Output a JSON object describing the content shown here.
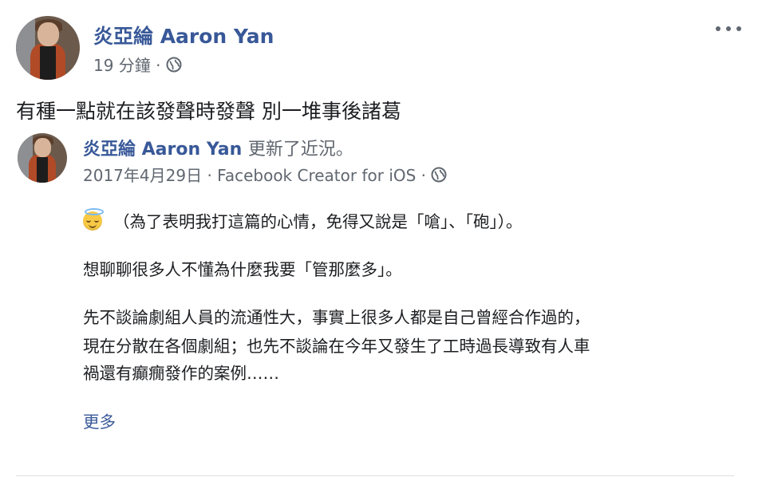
{
  "post": {
    "author": "炎亞綸 Aaron Yan",
    "time": "19 分鐘",
    "separator": "·",
    "text": "有種一點就在該發聲時發聲 別一堆事後諸葛",
    "privacy_icon": "globe-icon",
    "options_icon": "more-options-icon"
  },
  "shared": {
    "author": "炎亞綸 Aaron Yan",
    "action": "更新了近況。",
    "date": "2017年4月29日",
    "separator": "·",
    "source": "Facebook Creator for iOS",
    "privacy_icon": "globe-icon",
    "emoji_icon": "smiling-face-with-halo-icon",
    "paragraphs": [
      "（為了表明我打這篇的心情，免得又說是「嗆」、「砲」）。",
      "想聊聊很多人不懂為什麼我要「管那麼多」。",
      "先不談論劇組人員的流通性大，事實上很多人都是自己曾經合作過的，",
      "現在分散在各個劇組；也先不談論在今年又發生了工時過長導致有人車",
      "禍還有癲癇發作的案例……"
    ],
    "see_more": "更多"
  },
  "colors": {
    "link": "#385898",
    "meta": "#606770",
    "text": "#1c1e21",
    "divider": "#dddfe2"
  }
}
